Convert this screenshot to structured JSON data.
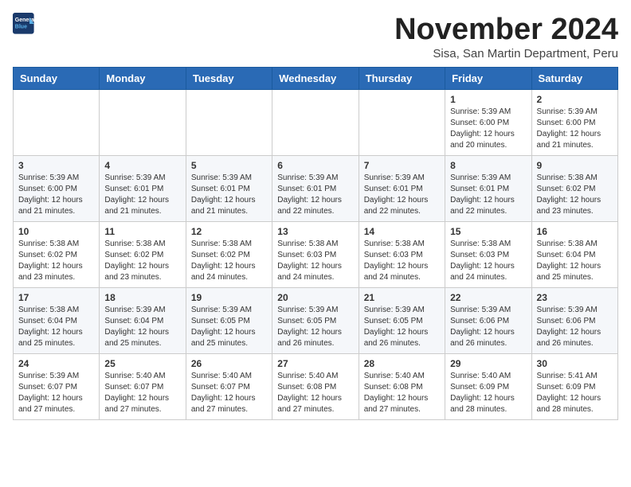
{
  "logo": {
    "line1": "General",
    "line2": "Blue"
  },
  "title": "November 2024",
  "subtitle": "Sisa, San Martin Department, Peru",
  "weekdays": [
    "Sunday",
    "Monday",
    "Tuesday",
    "Wednesday",
    "Thursday",
    "Friday",
    "Saturday"
  ],
  "weeks": [
    [
      {
        "day": "",
        "info": ""
      },
      {
        "day": "",
        "info": ""
      },
      {
        "day": "",
        "info": ""
      },
      {
        "day": "",
        "info": ""
      },
      {
        "day": "",
        "info": ""
      },
      {
        "day": "1",
        "info": "Sunrise: 5:39 AM\nSunset: 6:00 PM\nDaylight: 12 hours\nand 20 minutes."
      },
      {
        "day": "2",
        "info": "Sunrise: 5:39 AM\nSunset: 6:00 PM\nDaylight: 12 hours\nand 21 minutes."
      }
    ],
    [
      {
        "day": "3",
        "info": "Sunrise: 5:39 AM\nSunset: 6:00 PM\nDaylight: 12 hours\nand 21 minutes."
      },
      {
        "day": "4",
        "info": "Sunrise: 5:39 AM\nSunset: 6:01 PM\nDaylight: 12 hours\nand 21 minutes."
      },
      {
        "day": "5",
        "info": "Sunrise: 5:39 AM\nSunset: 6:01 PM\nDaylight: 12 hours\nand 21 minutes."
      },
      {
        "day": "6",
        "info": "Sunrise: 5:39 AM\nSunset: 6:01 PM\nDaylight: 12 hours\nand 22 minutes."
      },
      {
        "day": "7",
        "info": "Sunrise: 5:39 AM\nSunset: 6:01 PM\nDaylight: 12 hours\nand 22 minutes."
      },
      {
        "day": "8",
        "info": "Sunrise: 5:39 AM\nSunset: 6:01 PM\nDaylight: 12 hours\nand 22 minutes."
      },
      {
        "day": "9",
        "info": "Sunrise: 5:38 AM\nSunset: 6:02 PM\nDaylight: 12 hours\nand 23 minutes."
      }
    ],
    [
      {
        "day": "10",
        "info": "Sunrise: 5:38 AM\nSunset: 6:02 PM\nDaylight: 12 hours\nand 23 minutes."
      },
      {
        "day": "11",
        "info": "Sunrise: 5:38 AM\nSunset: 6:02 PM\nDaylight: 12 hours\nand 23 minutes."
      },
      {
        "day": "12",
        "info": "Sunrise: 5:38 AM\nSunset: 6:02 PM\nDaylight: 12 hours\nand 24 minutes."
      },
      {
        "day": "13",
        "info": "Sunrise: 5:38 AM\nSunset: 6:03 PM\nDaylight: 12 hours\nand 24 minutes."
      },
      {
        "day": "14",
        "info": "Sunrise: 5:38 AM\nSunset: 6:03 PM\nDaylight: 12 hours\nand 24 minutes."
      },
      {
        "day": "15",
        "info": "Sunrise: 5:38 AM\nSunset: 6:03 PM\nDaylight: 12 hours\nand 24 minutes."
      },
      {
        "day": "16",
        "info": "Sunrise: 5:38 AM\nSunset: 6:04 PM\nDaylight: 12 hours\nand 25 minutes."
      }
    ],
    [
      {
        "day": "17",
        "info": "Sunrise: 5:38 AM\nSunset: 6:04 PM\nDaylight: 12 hours\nand 25 minutes."
      },
      {
        "day": "18",
        "info": "Sunrise: 5:39 AM\nSunset: 6:04 PM\nDaylight: 12 hours\nand 25 minutes."
      },
      {
        "day": "19",
        "info": "Sunrise: 5:39 AM\nSunset: 6:05 PM\nDaylight: 12 hours\nand 25 minutes."
      },
      {
        "day": "20",
        "info": "Sunrise: 5:39 AM\nSunset: 6:05 PM\nDaylight: 12 hours\nand 26 minutes."
      },
      {
        "day": "21",
        "info": "Sunrise: 5:39 AM\nSunset: 6:05 PM\nDaylight: 12 hours\nand 26 minutes."
      },
      {
        "day": "22",
        "info": "Sunrise: 5:39 AM\nSunset: 6:06 PM\nDaylight: 12 hours\nand 26 minutes."
      },
      {
        "day": "23",
        "info": "Sunrise: 5:39 AM\nSunset: 6:06 PM\nDaylight: 12 hours\nand 26 minutes."
      }
    ],
    [
      {
        "day": "24",
        "info": "Sunrise: 5:39 AM\nSunset: 6:07 PM\nDaylight: 12 hours\nand 27 minutes."
      },
      {
        "day": "25",
        "info": "Sunrise: 5:40 AM\nSunset: 6:07 PM\nDaylight: 12 hours\nand 27 minutes."
      },
      {
        "day": "26",
        "info": "Sunrise: 5:40 AM\nSunset: 6:07 PM\nDaylight: 12 hours\nand 27 minutes."
      },
      {
        "day": "27",
        "info": "Sunrise: 5:40 AM\nSunset: 6:08 PM\nDaylight: 12 hours\nand 27 minutes."
      },
      {
        "day": "28",
        "info": "Sunrise: 5:40 AM\nSunset: 6:08 PM\nDaylight: 12 hours\nand 27 minutes."
      },
      {
        "day": "29",
        "info": "Sunrise: 5:40 AM\nSunset: 6:09 PM\nDaylight: 12 hours\nand 28 minutes."
      },
      {
        "day": "30",
        "info": "Sunrise: 5:41 AM\nSunset: 6:09 PM\nDaylight: 12 hours\nand 28 minutes."
      }
    ]
  ]
}
